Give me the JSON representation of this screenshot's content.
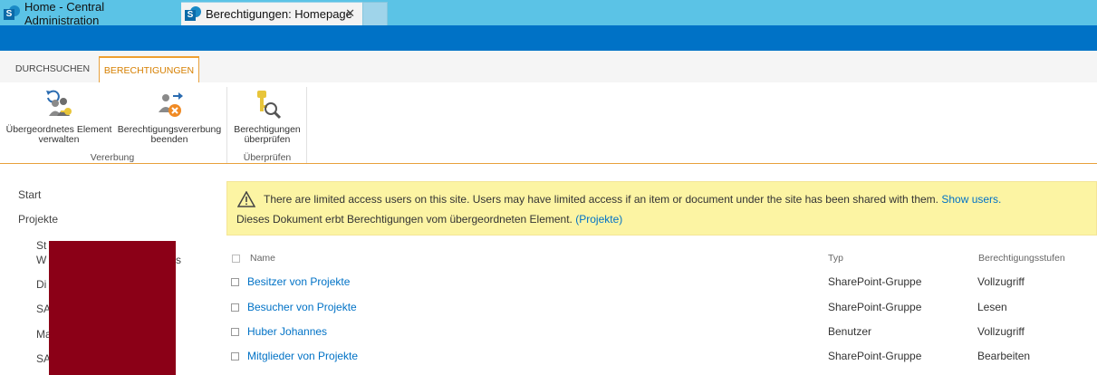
{
  "browser": {
    "tabs": [
      {
        "title": "Home - Central Administration",
        "active": false
      },
      {
        "title": "Berechtigungen: Homepage",
        "active": true
      }
    ],
    "close_glyph": "✕"
  },
  "ribbon": {
    "tabs": [
      "DURCHSUCHEN",
      "BERECHTIGUNGEN"
    ],
    "buttons": {
      "manage_parent": {
        "line1": "Übergeordnetes Element",
        "line2": "verwalten"
      },
      "stop_inheritance": {
        "line1": "Berechtigungsvererbung",
        "line2": "beenden"
      },
      "check_permissions": {
        "line1": "Berechtigungen",
        "line2": "überprüfen"
      }
    },
    "groups": [
      "Vererbung",
      "Überprüfen"
    ]
  },
  "nav": {
    "items": [
      "Start",
      "Projekte"
    ],
    "subitems": [
      "St",
      "W",
      "s",
      "Di",
      "SA",
      "Ma",
      "SA"
    ]
  },
  "banner": {
    "line1_text": "There are limited access users on this site. Users may have limited access if an item or document under the site has been shared with them.",
    "line1_link": "Show users.",
    "line2_text": "Dieses Dokument erbt Berechtigungen vom übergeordneten Element.",
    "line2_link": "(Projekte)"
  },
  "table": {
    "headers": {
      "name": "Name",
      "type": "Typ",
      "level": "Berechtigungsstufen"
    },
    "rows": [
      {
        "name": "Besitzer von Projekte",
        "type": "SharePoint-Gruppe",
        "level": "Vollzugriff"
      },
      {
        "name": "Besucher von Projekte",
        "type": "SharePoint-Gruppe",
        "level": "Lesen"
      },
      {
        "name": "Huber Johannes",
        "type": "Benutzer",
        "level": "Vollzugriff"
      },
      {
        "name": "Mitglieder von Projekte",
        "type": "SharePoint-Gruppe",
        "level": "Bearbeiten"
      }
    ]
  },
  "colors": {
    "suite_bar": "#0072c6",
    "tab_strip": "#5bc3e6",
    "accent_orange": "#e8a03c",
    "link": "#0072c6",
    "banner_bg": "#fcf4a3",
    "redaction": "#8b0017"
  }
}
